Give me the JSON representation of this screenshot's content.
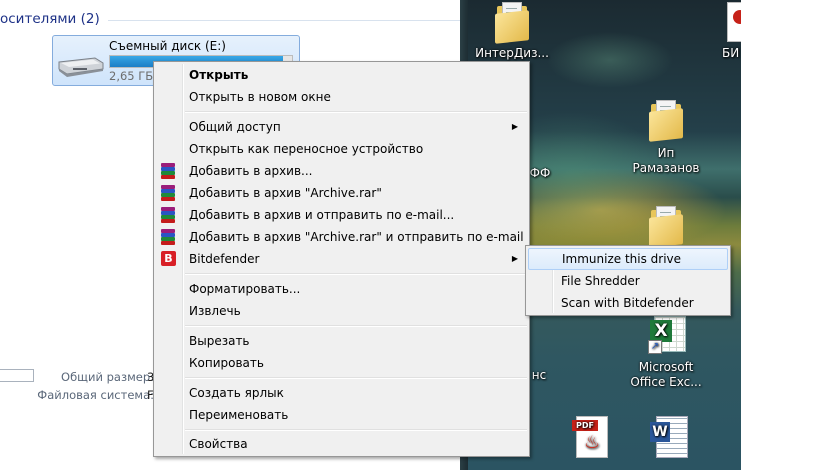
{
  "explorer": {
    "group_header": "осителями (2)",
    "drive": {
      "name": "Съемный диск (E:)",
      "free": "2,65 ГБ с",
      "used_fraction": 0.95
    },
    "details": {
      "total_label": "Общий размер:",
      "total_value": "3",
      "fs_label": "Файловая система:",
      "fs_value": "F"
    }
  },
  "desktop": {
    "icons": [
      {
        "label": "ИнтерДиз...",
        "kind": "folder"
      },
      {
        "label": "БИ",
        "kind": "doc"
      },
      {
        "label": "Ип\nРамазанов",
        "kind": "folder"
      },
      {
        "label": "ФФ",
        "kind": "folder-partial"
      },
      {
        "label": "Microsoft\nOffice Exc...",
        "kind": "excel"
      },
      {
        "label": "нс",
        "kind": "folder-partial"
      },
      {
        "label": "",
        "kind": "pdf"
      },
      {
        "label": "",
        "kind": "word"
      }
    ]
  },
  "context_menu": {
    "items": [
      {
        "label": "Открыть",
        "bold": true
      },
      {
        "label": "Открыть в новом окне"
      },
      {
        "label": "Общий доступ",
        "submenu": true
      },
      {
        "label": "Открыть как переносное устройство"
      },
      {
        "label": "Добавить в архив...",
        "icon": "winrar-icon"
      },
      {
        "label": "Добавить в архив \"Archive.rar\"",
        "icon": "winrar-icon"
      },
      {
        "label": "Добавить в архив и отправить по e-mail...",
        "icon": "winrar-icon"
      },
      {
        "label": "Добавить в архив \"Archive.rar\" и отправить по e-mail",
        "icon": "winrar-icon"
      },
      {
        "label": "Bitdefender",
        "icon": "bitdefender-icon",
        "submenu": true,
        "active": true
      },
      {
        "label": "Форматировать..."
      },
      {
        "label": "Извлечь"
      },
      {
        "label": "Вырезать"
      },
      {
        "label": "Копировать"
      },
      {
        "label": "Создать ярлык"
      },
      {
        "label": "Переименовать"
      },
      {
        "label": "Свойства"
      }
    ],
    "bitdefender_icon_letter": "B",
    "submenu_arrow": "▶"
  },
  "bitdefender_submenu": {
    "items": [
      {
        "label": "Immunize this drive",
        "highlighted": true
      },
      {
        "label": "File Shredder"
      },
      {
        "label": "Scan with Bitdefender"
      }
    ]
  },
  "colors": {
    "menu_bg": "#f0f0f0",
    "highlight": "#dcebfc",
    "bitdefender_red": "#d81f26",
    "group_header": "#1e3287"
  }
}
